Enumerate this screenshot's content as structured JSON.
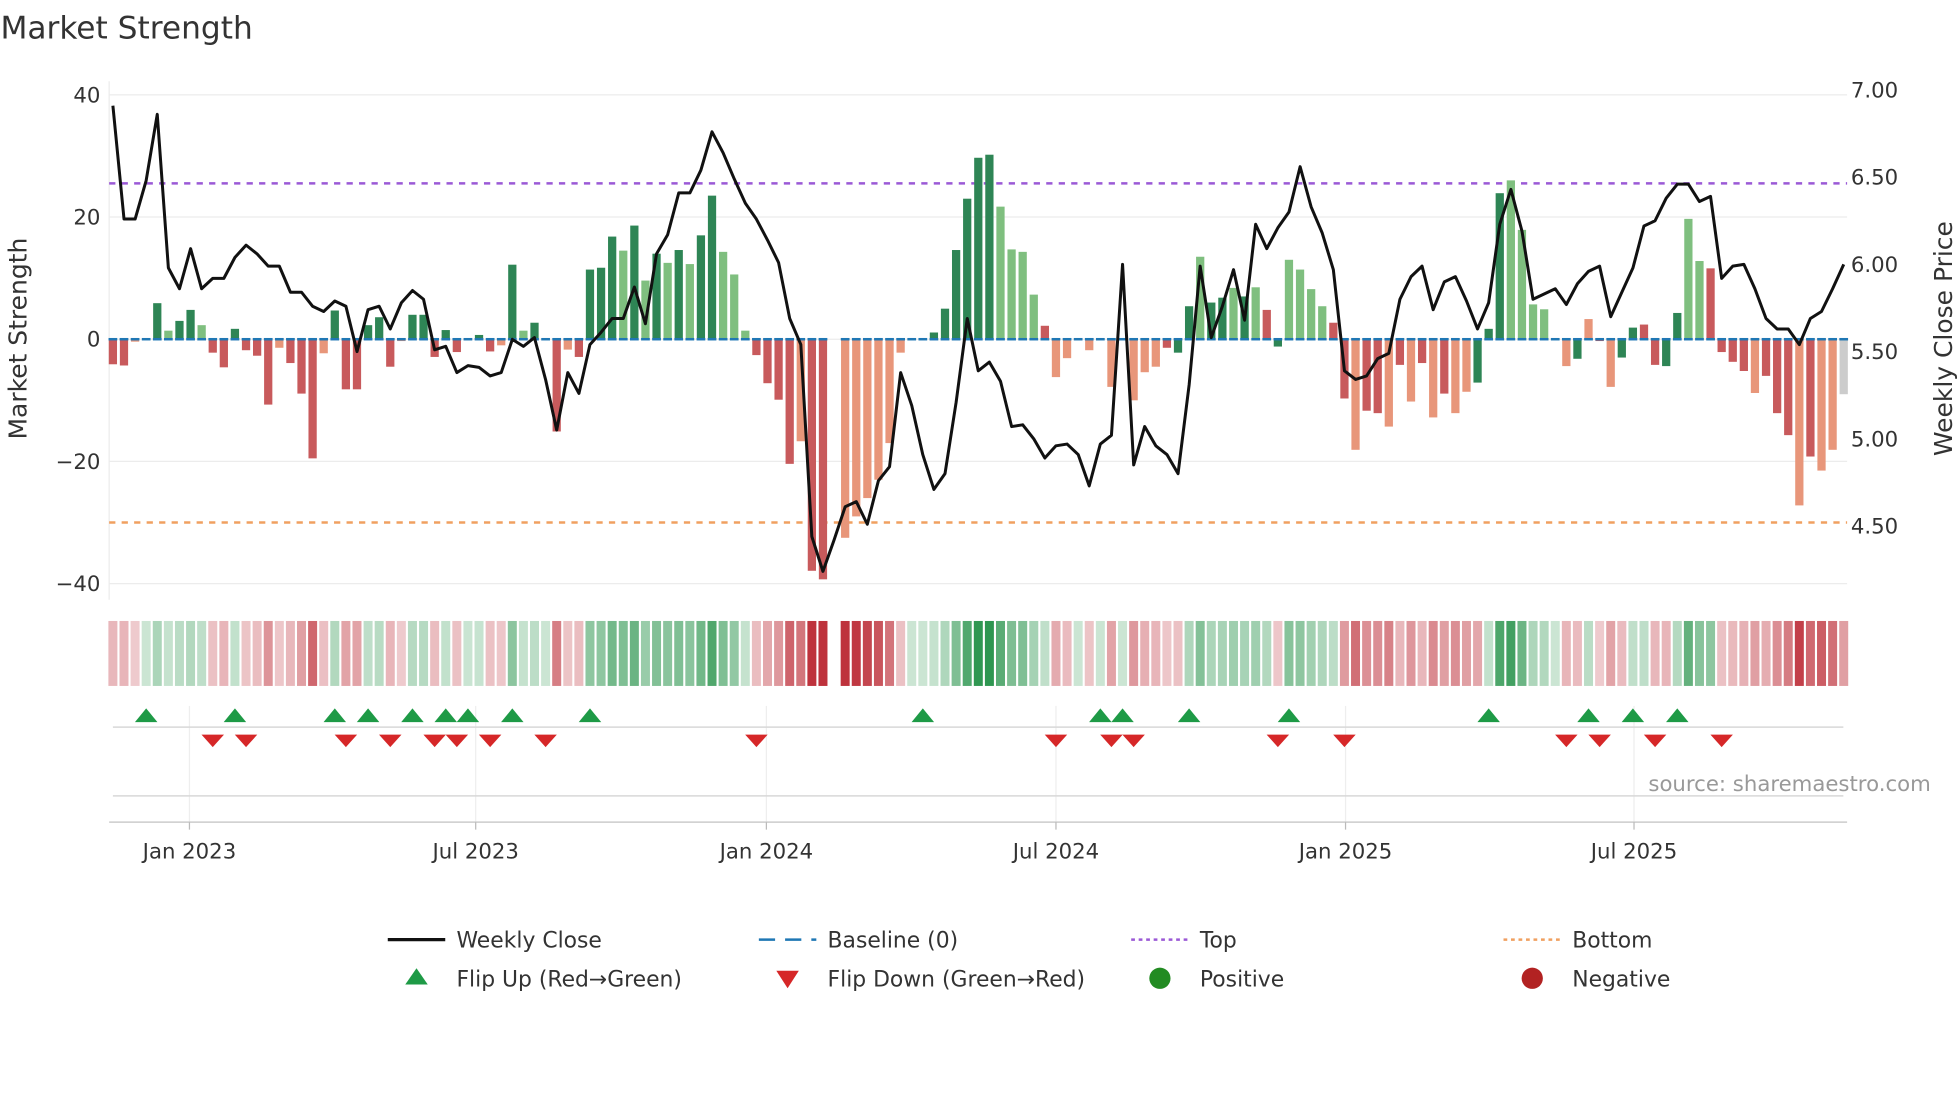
{
  "chart_data": {
    "type": "bar+line",
    "title": "Market Strength",
    "ylabel": "Market Strength",
    "y2label": "Weekly Close Price",
    "ylim": [
      -42,
      42
    ],
    "y2lim": [
      4.2,
      7.05
    ],
    "yticks": [
      "40",
      "20",
      "0",
      "−20",
      "−40"
    ],
    "ytick_values": [
      40,
      20,
      0,
      -20,
      -40
    ],
    "y2ticks": [
      "7.00",
      "6.50",
      "6.00",
      "5.50",
      "5.00",
      "4.50"
    ],
    "y2tick_values": [
      7.0,
      6.5,
      6.0,
      5.5,
      5.0,
      4.5
    ],
    "xticks": [
      {
        "label": "Jan 2023",
        "at_week": 6.9
      },
      {
        "label": "Jul 2023",
        "at_week": 32.7
      },
      {
        "label": "Jan 2024",
        "at_week": 58.9
      },
      {
        "label": "Jul 2024",
        "at_week": 85.0
      },
      {
        "label": "Jan 2025",
        "at_week": 111.1
      },
      {
        "label": "Jul 2025",
        "at_week": 137.1
      }
    ],
    "top_level": 25.5,
    "bottom_level": -30,
    "baseline": 0,
    "strength": [
      -4.1,
      -4.3,
      -0.4,
      0,
      5.9,
      1.4,
      3,
      4.8,
      2.3,
      -2.2,
      -4.6,
      1.7,
      -1.8,
      -2.7,
      -10.7,
      -1.4,
      -3.9,
      -8.9,
      -19.5,
      -2.3,
      4.7,
      -8.2,
      -8.2,
      2.3,
      3.6,
      -4.5,
      -0.3,
      4,
      4,
      -2.9,
      1.5,
      -2.1,
      0.2,
      0.7,
      -2,
      -1,
      12.2,
      1.4,
      2.7,
      0,
      -15.1,
      -1.7,
      -2.9,
      11.4,
      11.7,
      16.8,
      14.5,
      18.6,
      9.6,
      14,
      12.5,
      14.6,
      12.3,
      17,
      23.5,
      14.3,
      10.6,
      1.4,
      -2.6,
      -7.2,
      -9.9,
      -20.4,
      -16.7,
      -37.9,
      -39.3,
      null,
      -32.5,
      -29,
      -26,
      -23,
      -17,
      -2.2,
      0,
      0,
      1.1,
      5,
      14.6,
      23,
      29.7,
      30.2,
      21.7,
      14.7,
      14.3,
      7.3,
      2.2,
      -6.2,
      -3.1,
      0,
      -1.8,
      0,
      -7.8,
      0,
      -10,
      -5.4,
      -4.5,
      -1.4,
      -2.2,
      5.4,
      13.5,
      6,
      6.8,
      8.4,
      7,
      8.5,
      4.8,
      -1.2,
      13,
      11.4,
      8.2,
      5.4,
      2.7,
      -9.7,
      -18.1,
      -11.7,
      -12.1,
      -14.3,
      -4.2,
      -10.2,
      -3.9,
      -12.8,
      -8.9,
      -12.1,
      -8.6,
      -7.1,
      1.7,
      23.9,
      26,
      17.9,
      5.7,
      4.9,
      0,
      -4.4,
      -3.2,
      3.3,
      -0.3,
      -7.8,
      -3,
      1.9,
      2.4,
      -4.2,
      -4.4,
      4.3,
      19.7,
      12.8,
      11.6,
      -2.1,
      -3.7,
      -5.2,
      -8.8,
      -6,
      -12.1,
      -15.7,
      -27.2,
      -19.2,
      -21.5,
      -18.1,
      -9
    ],
    "shade": "RRrgGgGGgRRGRRRrRRRrGRRGGRrGGRGRgGRrGgGgRrRGGGgGgGgGgGGgggRRRRrRRxrrrrrrggGGGGGGggggRrrRrRrRrrrRGGgGGgGgRGggggRRrRRrRrRrRrrGGGggggRrGrRrGGRRGGggRRRRrRRRrRrr",
    "weekly_close": [
      6.91,
      6.26,
      6.26,
      6.48,
      6.86,
      5.98,
      5.86,
      6.09,
      5.86,
      5.92,
      5.92,
      6.04,
      6.11,
      6.06,
      5.99,
      5.99,
      5.84,
      5.84,
      5.76,
      5.73,
      5.79,
      5.76,
      5.5,
      5.74,
      5.76,
      5.63,
      5.78,
      5.85,
      5.8,
      5.51,
      5.53,
      5.38,
      5.42,
      5.41,
      5.36,
      5.38,
      5.57,
      5.53,
      5.58,
      5.34,
      5.05,
      5.38,
      5.26,
      5.54,
      5.61,
      5.69,
      5.69,
      5.87,
      5.66,
      6.06,
      6.17,
      6.41,
      6.41,
      6.54,
      6.76,
      6.64,
      6.49,
      6.35,
      6.26,
      6.14,
      6.01,
      5.69,
      5.54,
      4.44,
      4.24,
      4.42,
      4.61,
      4.64,
      4.51,
      4.76,
      4.84,
      5.38,
      5.19,
      4.91,
      4.71,
      4.8,
      5.21,
      5.69,
      5.39,
      5.44,
      5.33,
      5.07,
      5.08,
      5.0,
      4.89,
      4.96,
      4.97,
      4.91,
      4.73,
      4.97,
      5.02,
      6.0,
      4.85,
      5.07,
      4.96,
      4.91,
      4.8,
      5.31,
      5.99,
      5.58,
      5.76,
      5.97,
      5.68,
      6.23,
      6.09,
      6.21,
      6.3,
      6.56,
      6.33,
      6.18,
      5.97,
      5.39,
      5.34,
      5.36,
      5.46,
      5.49,
      5.8,
      5.93,
      5.99,
      5.74,
      5.9,
      5.93,
      5.79,
      5.63,
      5.78,
      6.23,
      6.43,
      6.19,
      5.8,
      5.83,
      5.86,
      5.77,
      5.89,
      5.96,
      5.99,
      5.7,
      5.84,
      5.98,
      6.22,
      6.25,
      6.38,
      6.46,
      6.46,
      6.36,
      6.39,
      5.92,
      5.99,
      6.0,
      5.86,
      5.69,
      5.63,
      5.63,
      5.54,
      5.69,
      5.73,
      5.86,
      6.0
    ],
    "flip_up_weeks": [
      3,
      11,
      20,
      23,
      27,
      30,
      32,
      36,
      43,
      73,
      89,
      91,
      97,
      106,
      124,
      133,
      137,
      141
    ],
    "flip_down_weeks": [
      9,
      12,
      21,
      25,
      29,
      31,
      34,
      39,
      58,
      85,
      90,
      92,
      105,
      111,
      131,
      134,
      139,
      145
    ],
    "legend": {
      "placement": "bottom",
      "items": [
        {
          "label": "Weekly Close",
          "kind": "line"
        },
        {
          "label": "Baseline (0)",
          "kind": "dash"
        },
        {
          "label": "Top",
          "kind": "dot-purple"
        },
        {
          "label": "Bottom",
          "kind": "dot-orange"
        },
        {
          "label": "Flip Up (Red→Green)",
          "kind": "tri-up"
        },
        {
          "label": "Flip Down (Green→Red)",
          "kind": "tri-down"
        },
        {
          "label": "Positive",
          "kind": "circle-green"
        },
        {
          "label": "Negative",
          "kind": "circle-red"
        }
      ]
    },
    "source": "source: sharemaestro.com"
  },
  "colors": {
    "strong_green": "#2e8555",
    "light_green": "#7fbf7f",
    "strong_red": "#c85a5c",
    "light_red": "#e8967a",
    "line": "#111111",
    "baseline": "#1f77b4",
    "top": "#9b59d6",
    "bottom": "#f0a060",
    "flip_up": "#1e9a46",
    "flip_down": "#d62728",
    "positive": "#228b22",
    "negative": "#b22222"
  }
}
